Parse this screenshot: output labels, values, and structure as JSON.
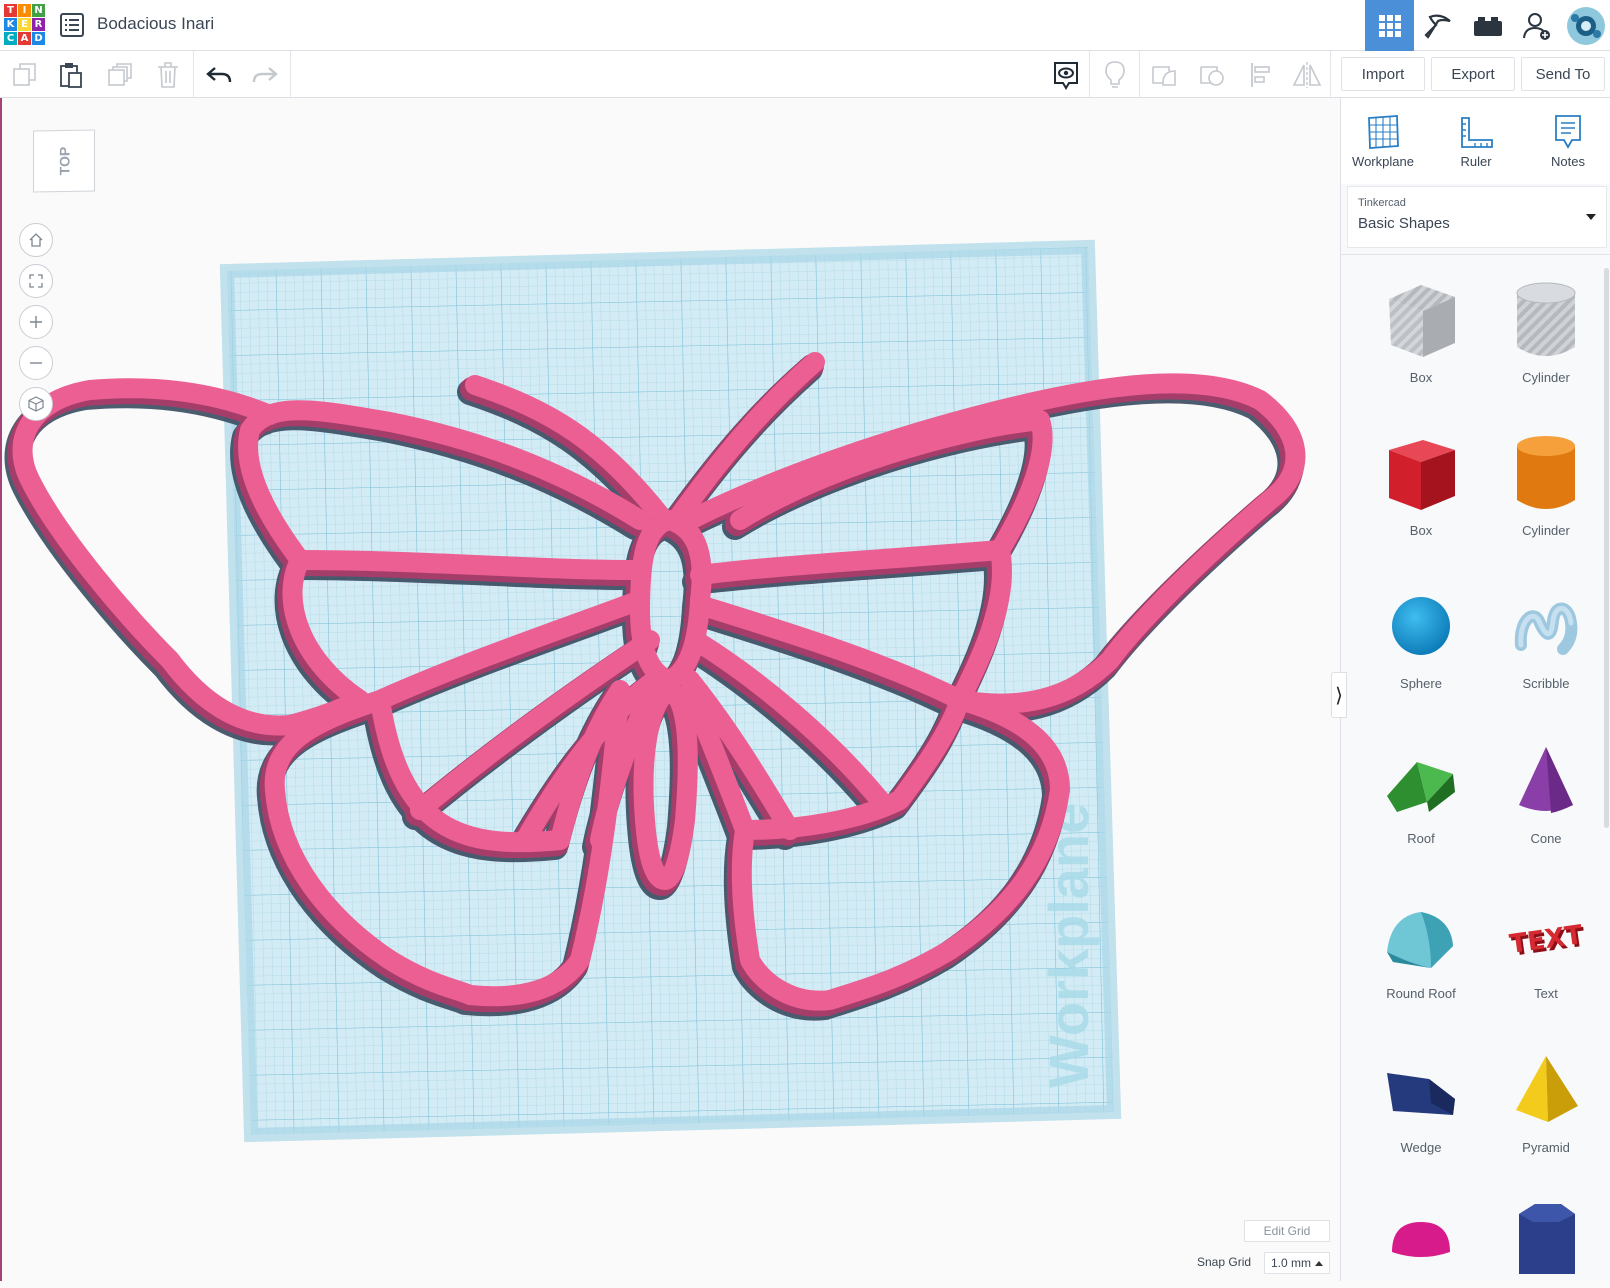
{
  "app": {
    "brand": {
      "letters": [
        "T",
        "I",
        "N",
        "K",
        "E",
        "R",
        "C",
        "A",
        "D"
      ],
      "colors": [
        "#e53935",
        "#fb8c00",
        "#43a047",
        "#1e88e5",
        "#fdd835",
        "#8e24aa",
        "#00acc1",
        "#e53935",
        "#1e88e5"
      ]
    },
    "document_title": "Bodacious Inari"
  },
  "topbar": {
    "icons": [
      "3d-design-grid-icon",
      "codeblocks-pickaxe-icon",
      "bricks-icon",
      "add-user-icon",
      "avatar"
    ]
  },
  "toolbar": {
    "left_tools": [
      "copy-icon",
      "paste-icon",
      "duplicate-icon",
      "delete-icon",
      "undo-icon",
      "redo-icon"
    ],
    "right_tools": [
      "show-all-icon",
      "light-bulb-icon",
      "group-icon",
      "ungroup-icon",
      "align-icon",
      "mirror-icon"
    ],
    "import_label": "Import",
    "export_label": "Export",
    "send_to_label": "Send To"
  },
  "viewcube": {
    "face": "TOP"
  },
  "nav": [
    "home-view-icon",
    "fit-view-icon",
    "zoom-in-icon",
    "zoom-out-icon",
    "ortho-view-icon"
  ],
  "workplane": {
    "watermark": "Workplane"
  },
  "panel": {
    "tools": [
      {
        "label": "Workplane"
      },
      {
        "label": "Ruler"
      },
      {
        "label": "Notes"
      }
    ],
    "library": {
      "caption": "Tinkercad",
      "value": "Basic Shapes"
    },
    "shapes": [
      {
        "label": "Box"
      },
      {
        "label": "Cylinder"
      },
      {
        "label": "Box"
      },
      {
        "label": "Cylinder"
      },
      {
        "label": "Sphere"
      },
      {
        "label": "Scribble"
      },
      {
        "label": "Roof"
      },
      {
        "label": "Cone"
      },
      {
        "label": "Round Roof"
      },
      {
        "label": "Text"
      },
      {
        "label": "Wedge"
      },
      {
        "label": "Pyramid"
      }
    ]
  },
  "grid": {
    "edit_grid_label": "Edit Grid",
    "snap_label": "Snap Grid",
    "snap_value": "1.0 mm"
  },
  "colors": {
    "accent": "#4a8fd8",
    "shape_pink": "#ec5f93",
    "workplane_blue": "#cfe9f2"
  }
}
